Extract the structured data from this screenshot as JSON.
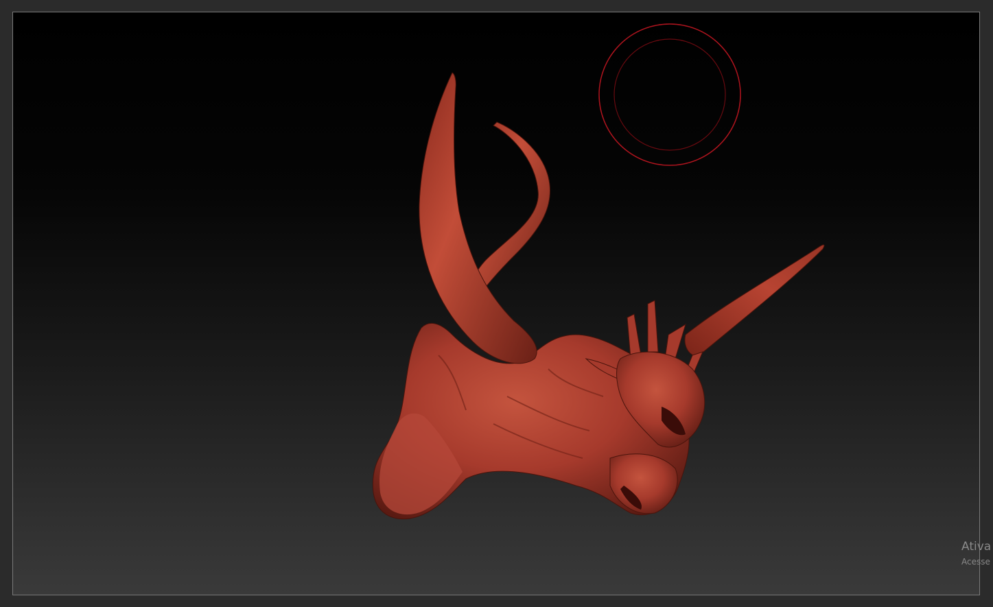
{
  "viewport": {
    "brush_ring_color": "#b0141e",
    "model_color": "#a63a2c"
  },
  "watermark": {
    "title": "Ativa",
    "subtitle": "Acesse"
  }
}
